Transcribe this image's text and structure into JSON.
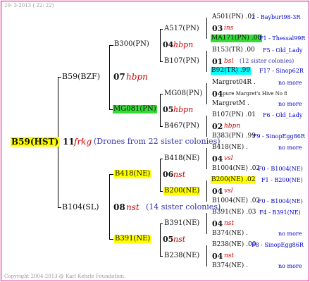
{
  "header": {
    "date": "20-  3-2013 ( 22: 22)"
  },
  "footer": {
    "copyright": "Copyright 2004-2013 @ Karl Kehrle Foundation."
  },
  "root": {
    "label": "B59(HST)",
    "number": "11",
    "code": "frkg",
    "drones": "(Drones from 22 sister colonies)"
  },
  "gen1": [
    {
      "label": "B59(BZF)",
      "number": "07",
      "code": "hbpn"
    },
    {
      "label": "B104(SL)",
      "number": "08",
      "code": "nst",
      "note": "(14 sister colonies)"
    }
  ],
  "gen2": [
    {
      "label": "B300(PN)",
      "number": "04",
      "code": "hbpn"
    },
    {
      "label": "MG081(PN)",
      "number": "05",
      "code": "hbpn"
    },
    {
      "label": "B418(NE)",
      "number": "06",
      "code": "nst"
    },
    {
      "label": "B391(NE)",
      "number": "05",
      "code": "nst"
    }
  ],
  "gen3": [
    {
      "label": "A517(PN)"
    },
    {
      "label": "B107(PN)"
    },
    {
      "label": "MG08(PN)"
    },
    {
      "label": "B467(PN)"
    },
    {
      "label": "B418(NE)"
    },
    {
      "label": "B200(NE)"
    },
    {
      "label": "B391(NE)"
    },
    {
      "label": "B238(NE)"
    }
  ],
  "gen4": [
    {
      "top": "A501(PN) .01",
      "top_right": "2 - Bayburt98-3R",
      "number": "03",
      "code": "ins",
      "bottom": "MA171(PN) .00",
      "bottom_right": "F1 - Thessal99R"
    },
    {
      "top": "B153(TR) .00",
      "top_right": "F5 - Old_Lady",
      "number": "01",
      "code": "bsl",
      "note": "(12 sister colonies)",
      "bottom": "B92(TR) .99",
      "bottom_right": "F17 - Sinop62R"
    },
    {
      "top": "Margret04R .",
      "top_right": "no more",
      "number": "04",
      "code": "pure Margret's Hive No 8",
      "bottom": "MargretM .",
      "bottom_right": "no more"
    },
    {
      "top": "B107(PN) .01",
      "top_right": "F6 - Old_Lady",
      "number": "02",
      "code": "hbpn",
      "bottom": "B383(PN) .99",
      "bottom_right": "F9 - SinopEgg86R"
    },
    {
      "top": "B418(NE) .",
      "top_right": "no more",
      "number": "04",
      "code": "vsl",
      "bottom": "B1004(NE) .02",
      "bottom_right": "F0 - B1004(NE)"
    },
    {
      "top": "B200(NE) .02",
      "top_right": "F1 - B200(NE)",
      "number": "04",
      "code": "vsl",
      "bottom": "B1004(NE) .02",
      "bottom_right": "F0 - B1004(NE)"
    },
    {
      "top": "B391(NE) .03",
      "top_right": "F4 - B391(NE)",
      "number": "04",
      "code": "nst",
      "bottom": "B374(NE) .",
      "bottom_right": "no more"
    },
    {
      "top": "B238(NE) .00",
      "top_right": "F8 - SinopEgg86R",
      "number": "04",
      "code": "nst",
      "bottom": "B374(NE) .",
      "bottom_right": "no more"
    }
  ]
}
